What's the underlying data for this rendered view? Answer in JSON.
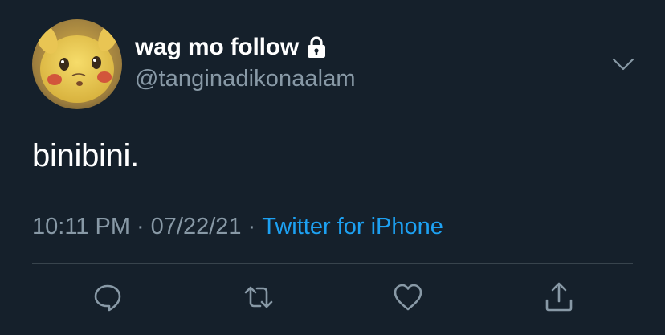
{
  "tweet": {
    "display_name": "wag mo follow",
    "handle": "@tanginadikonaalam",
    "text": "binibini.",
    "time": "10:11 PM",
    "separator": "·",
    "date": "07/22/21",
    "source": "Twitter for iPhone"
  },
  "icons": {
    "protected": "lock-icon",
    "more": "chevron-down-icon",
    "reply": "reply-icon",
    "retweet": "retweet-icon",
    "like": "heart-icon",
    "share": "share-icon"
  },
  "colors": {
    "background": "#15202b",
    "primary_text": "#ffffff",
    "secondary_text": "#8899a6",
    "link": "#1da1f2",
    "divider": "#38444d"
  }
}
